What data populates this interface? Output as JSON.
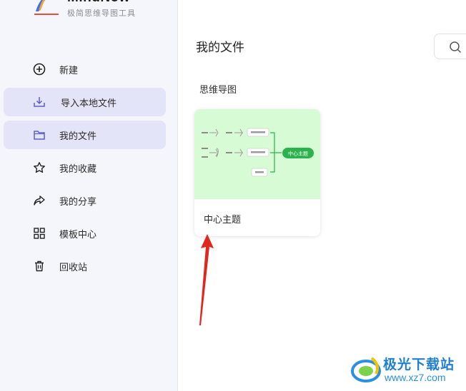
{
  "app": {
    "name": "MindNow",
    "tagline": "极简思维导图工具"
  },
  "sidebar": {
    "items": [
      {
        "label": "新建",
        "icon": "plus-circle-icon"
      },
      {
        "label": "导入本地文件",
        "icon": "import-icon"
      },
      {
        "label": "我的文件",
        "icon": "folder-icon"
      },
      {
        "label": "我的收藏",
        "icon": "star-icon"
      },
      {
        "label": "我的分享",
        "icon": "share-icon"
      },
      {
        "label": "模板中心",
        "icon": "grid-icon"
      },
      {
        "label": "回收站",
        "icon": "trash-icon"
      }
    ]
  },
  "main": {
    "title": "我的文件",
    "section": "思维导图",
    "files": [
      {
        "name": "中心主题",
        "thumb_center": "中心主题"
      }
    ]
  },
  "watermark": {
    "text": "极光下载站",
    "url": "www.xz7.com"
  },
  "colors": {
    "accent": "#e4e4f8",
    "thumb_bg": "#d7fbd5",
    "mindmap_green": "#2bb24c",
    "arrow": "#e1261c",
    "watermark_blue": "#1e7fd4"
  }
}
